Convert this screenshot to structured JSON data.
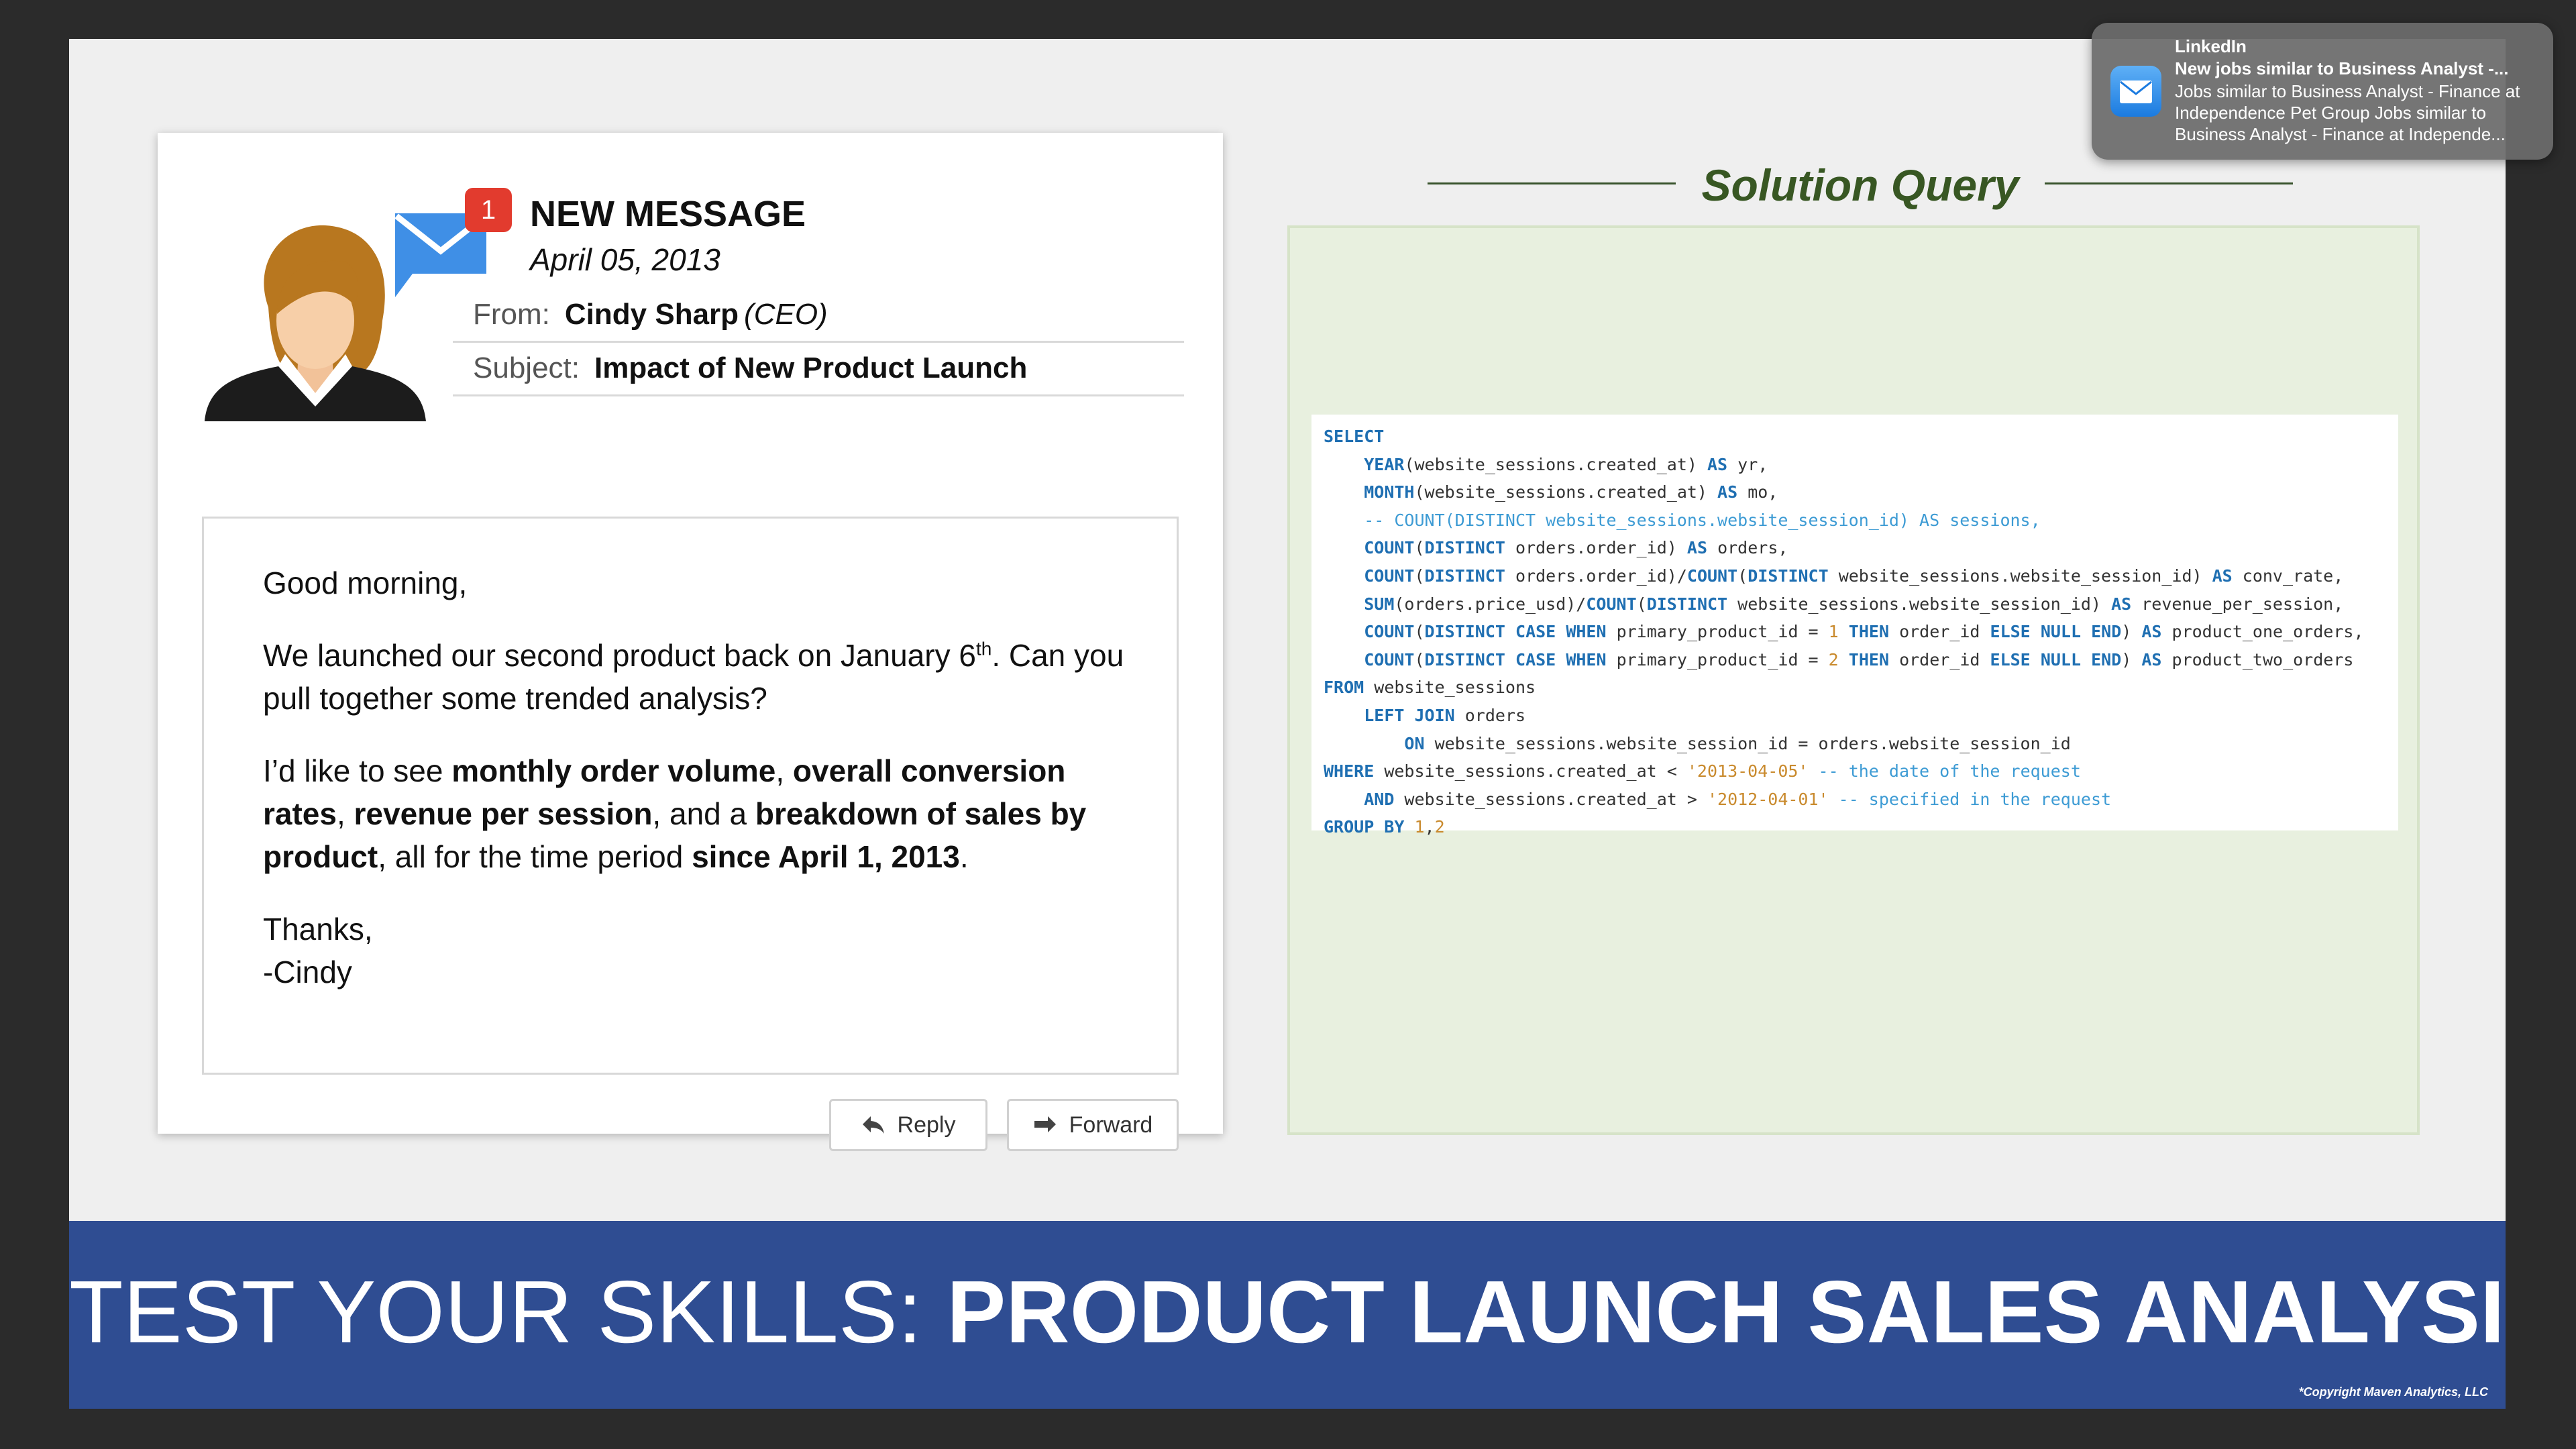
{
  "email": {
    "badge_count": "1",
    "title": "NEW MESSAGE",
    "date": "April 05, 2013",
    "from_label": "From:",
    "from_name": "Cindy Sharp",
    "from_role": "(CEO)",
    "subject_label": "Subject:",
    "subject": "Impact of New Product Launch",
    "greeting": "Good morning,",
    "p1_a": "We launched our second product back on January 6",
    "p1_sup": "th",
    "p1_b": ". Can you pull together some trended analysis?",
    "p2_a": "I’d like to see ",
    "p2_b": "monthly order volume",
    "p2_c": ", ",
    "p2_d": "overall conversion rates",
    "p2_e": ", ",
    "p2_f": "revenue per session",
    "p2_g": ", and a ",
    "p2_h": "breakdown of sales by product",
    "p2_i": ", all for the time period ",
    "p2_j": "since April 1, 2013",
    "p2_k": ".",
    "thanks": "Thanks,",
    "signoff": "-Cindy",
    "reply_label": "Reply",
    "forward_label": "Forward",
    "icon_colors": {
      "envelope": "#3f8fe6",
      "badge": "#e23b2e"
    }
  },
  "solution": {
    "title": "Solution Query",
    "sql": [
      [
        [
          "kw",
          "SELECT"
        ]
      ],
      [
        [
          "t",
          "    "
        ],
        [
          "kw",
          "YEAR"
        ],
        [
          "t",
          "(website_sessions.created_at) "
        ],
        [
          "kw",
          "AS"
        ],
        [
          "t",
          " yr,"
        ]
      ],
      [
        [
          "t",
          "    "
        ],
        [
          "kw",
          "MONTH"
        ],
        [
          "t",
          "(website_sessions.created_at) "
        ],
        [
          "kw",
          "AS"
        ],
        [
          "t",
          " mo,"
        ]
      ],
      [
        [
          "t",
          "    "
        ],
        [
          "cm",
          "-- COUNT(DISTINCT website_sessions.website_session_id) AS sessions,"
        ]
      ],
      [
        [
          "t",
          "    "
        ],
        [
          "kw",
          "COUNT"
        ],
        [
          "t",
          "("
        ],
        [
          "kw",
          "DISTINCT"
        ],
        [
          "t",
          " orders.order_id) "
        ],
        [
          "kw",
          "AS"
        ],
        [
          "t",
          " orders,"
        ]
      ],
      [
        [
          "t",
          "    "
        ],
        [
          "kw",
          "COUNT"
        ],
        [
          "t",
          "("
        ],
        [
          "kw",
          "DISTINCT"
        ],
        [
          "t",
          " orders.order_id)/"
        ],
        [
          "kw",
          "COUNT"
        ],
        [
          "t",
          "("
        ],
        [
          "kw",
          "DISTINCT"
        ],
        [
          "t",
          " website_sessions.website_session_id) "
        ],
        [
          "kw",
          "AS"
        ],
        [
          "t",
          " conv_rate,"
        ]
      ],
      [
        [
          "t",
          "    "
        ],
        [
          "kw",
          "SUM"
        ],
        [
          "t",
          "(orders.price_usd)/"
        ],
        [
          "kw",
          "COUNT"
        ],
        [
          "t",
          "("
        ],
        [
          "kw",
          "DISTINCT"
        ],
        [
          "t",
          " website_sessions.website_session_id) "
        ],
        [
          "kw",
          "AS"
        ],
        [
          "t",
          " revenue_per_session,"
        ]
      ],
      [
        [
          "t",
          "    "
        ],
        [
          "kw",
          "COUNT"
        ],
        [
          "t",
          "("
        ],
        [
          "kw",
          "DISTINCT"
        ],
        [
          "t",
          " "
        ],
        [
          "kw",
          "CASE"
        ],
        [
          "t",
          " "
        ],
        [
          "kw",
          "WHEN"
        ],
        [
          "t",
          " primary_product_id = "
        ],
        [
          "st",
          "1"
        ],
        [
          "t",
          " "
        ],
        [
          "kw",
          "THEN"
        ],
        [
          "t",
          " order_id "
        ],
        [
          "kw",
          "ELSE"
        ],
        [
          "t",
          " "
        ],
        [
          "kw",
          "NULL"
        ],
        [
          "t",
          " "
        ],
        [
          "kw",
          "END"
        ],
        [
          "t",
          ") "
        ],
        [
          "kw",
          "AS"
        ],
        [
          "t",
          " product_one_orders,"
        ]
      ],
      [
        [
          "t",
          "    "
        ],
        [
          "kw",
          "COUNT"
        ],
        [
          "t",
          "("
        ],
        [
          "kw",
          "DISTINCT"
        ],
        [
          "t",
          " "
        ],
        [
          "kw",
          "CASE"
        ],
        [
          "t",
          " "
        ],
        [
          "kw",
          "WHEN"
        ],
        [
          "t",
          " primary_product_id = "
        ],
        [
          "st",
          "2"
        ],
        [
          "t",
          " "
        ],
        [
          "kw",
          "THEN"
        ],
        [
          "t",
          " order_id "
        ],
        [
          "kw",
          "ELSE"
        ],
        [
          "t",
          " "
        ],
        [
          "kw",
          "NULL"
        ],
        [
          "t",
          " "
        ],
        [
          "kw",
          "END"
        ],
        [
          "t",
          ") "
        ],
        [
          "kw",
          "AS"
        ],
        [
          "t",
          " product_two_orders"
        ]
      ],
      [
        [
          "kw",
          "FROM"
        ],
        [
          "t",
          " website_sessions"
        ]
      ],
      [
        [
          "t",
          "    "
        ],
        [
          "kw",
          "LEFT JOIN"
        ],
        [
          "t",
          " orders"
        ]
      ],
      [
        [
          "t",
          "        "
        ],
        [
          "kw",
          "ON"
        ],
        [
          "t",
          " website_sessions.website_session_id = orders.website_session_id"
        ]
      ],
      [
        [
          "kw",
          "WHERE"
        ],
        [
          "t",
          " website_sessions.created_at < "
        ],
        [
          "st",
          "'2013-04-05'"
        ],
        [
          "t",
          " "
        ],
        [
          "cm",
          "-- the date of the request"
        ]
      ],
      [
        [
          "t",
          "    "
        ],
        [
          "kw",
          "AND"
        ],
        [
          "t",
          " website_sessions.created_at > "
        ],
        [
          "st",
          "'2012-04-01'"
        ],
        [
          "t",
          " "
        ],
        [
          "cm",
          "-- specified in the request"
        ]
      ],
      [
        [
          "kw",
          "GROUP BY"
        ],
        [
          "t",
          " "
        ],
        [
          "st",
          "1"
        ],
        [
          "t",
          ","
        ],
        [
          "st",
          "2"
        ]
      ]
    ],
    "colors": {
      "title": "#385723",
      "keyword": "#1f6fb2",
      "comment": "#3d9bd4",
      "literal": "#c98a2d"
    }
  },
  "banner": {
    "title_light": "TEST YOUR SKILLS: ",
    "title_bold": "PRODUCT LAUNCH SALES ANALYSIS",
    "copyright": "*Copyright Maven Analytics, LLC",
    "color": "#2f4d92"
  },
  "notification": {
    "app": "LinkedIn",
    "title": "New jobs similar to Business Analyst -...",
    "body": "Jobs similar to Business Analyst - Finance at Independence Pet Group Jobs similar to Business Analyst - Finance at Independe...",
    "icon": "mail-icon"
  }
}
